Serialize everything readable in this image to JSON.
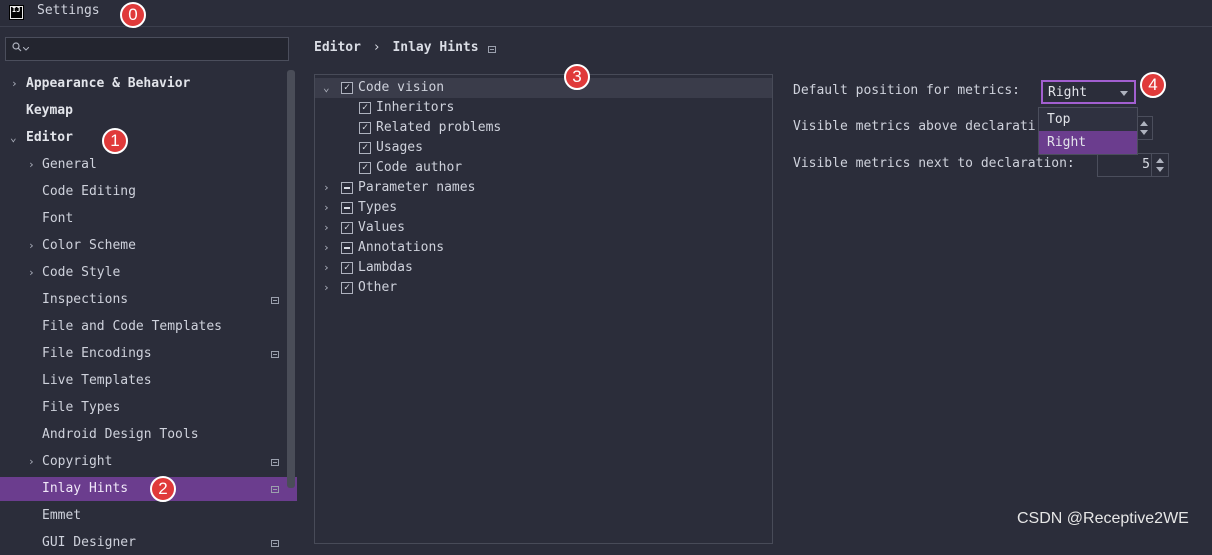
{
  "window": {
    "title": "Settings",
    "app_icon_text": "IJ"
  },
  "annotations": [
    "0",
    "1",
    "2",
    "3",
    "4"
  ],
  "sidebar": {
    "items": [
      {
        "label": "Appearance & Behavior",
        "expandable": true,
        "bold": true
      },
      {
        "label": "Keymap",
        "bold": true
      },
      {
        "label": "Editor",
        "expanded": true,
        "bold": true
      },
      {
        "label": "General",
        "expandable": true
      },
      {
        "label": "Code Editing"
      },
      {
        "label": "Font"
      },
      {
        "label": "Color Scheme",
        "expandable": true
      },
      {
        "label": "Code Style",
        "expandable": true
      },
      {
        "label": "Inspections",
        "icon": "project-settings-icon"
      },
      {
        "label": "File and Code Templates"
      },
      {
        "label": "File Encodings",
        "icon": "project-settings-icon"
      },
      {
        "label": "Live Templates"
      },
      {
        "label": "File Types"
      },
      {
        "label": "Android Design Tools"
      },
      {
        "label": "Copyright",
        "expandable": true,
        "icon": "project-settings-icon"
      },
      {
        "label": "Inlay Hints",
        "selected": true,
        "icon": "project-settings-icon"
      },
      {
        "label": "Emmet"
      },
      {
        "label": "GUI Designer",
        "icon": "project-settings-icon"
      }
    ]
  },
  "breadcrumb": {
    "parent": "Editor",
    "separator": "›",
    "current": "Inlay Hints"
  },
  "hints": [
    {
      "label": "Code vision",
      "state": "checked",
      "expanded": true,
      "highlighted": true
    },
    {
      "label": "Inheritors",
      "state": "checked",
      "child": true
    },
    {
      "label": "Related problems",
      "state": "checked",
      "child": true
    },
    {
      "label": "Usages",
      "state": "checked",
      "child": true
    },
    {
      "label": "Code author",
      "state": "checked",
      "child": true
    },
    {
      "label": "Parameter names",
      "state": "partial",
      "expandable": true
    },
    {
      "label": "Types",
      "state": "partial",
      "expandable": true
    },
    {
      "label": "Values",
      "state": "checked",
      "expandable": true
    },
    {
      "label": "Annotations",
      "state": "partial",
      "expandable": true
    },
    {
      "label": "Lambdas",
      "state": "checked",
      "expandable": true
    },
    {
      "label": "Other",
      "state": "checked",
      "expandable": true
    }
  ],
  "settings": {
    "default_position_label": "Default position for metrics:",
    "default_position_value": "Right",
    "position_options": [
      "Top",
      "Right"
    ],
    "above_label": "Visible metrics above declarati",
    "above_value": "",
    "next_label": "Visible metrics next to declaration:",
    "next_value": "5"
  },
  "watermark": "CSDN @Receptive2WE",
  "colors": {
    "selection": "#6b3d8e",
    "focus_border": "#a25fd0",
    "badge": "#e03a3a",
    "background": "#2b2d3a"
  }
}
